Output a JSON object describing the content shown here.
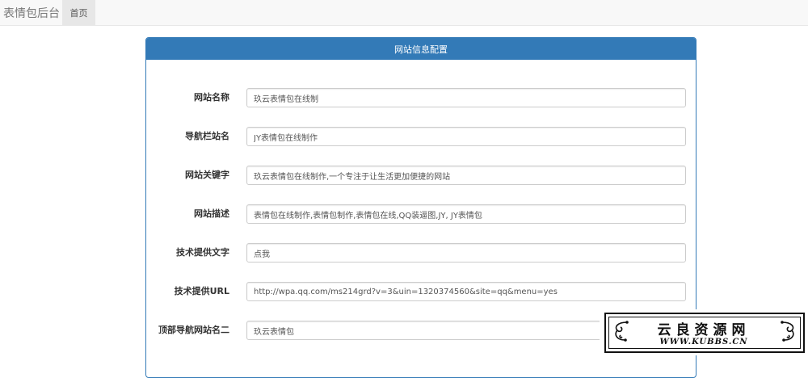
{
  "navbar": {
    "brand": "表情包后台",
    "home": "首页"
  },
  "panel": {
    "title": "网站信息配置"
  },
  "form": [
    {
      "label": "网站名称",
      "value": "玖云表情包在线制"
    },
    {
      "label": "导航栏站名",
      "value": "JY表情包在线制作"
    },
    {
      "label": "网站关键字",
      "value": "玖云表情包在线制作,一个专注于让生活更加便捷的网站"
    },
    {
      "label": "网站描述",
      "value": "表情包在线制作,表情包制作,表情包在线,QQ装逼图,JY, JY表情包"
    },
    {
      "label": "技术提供文字",
      "value": "点我"
    },
    {
      "label": "技术提供URL",
      "value": "http://wpa.qq.com/ms214grd?v=3&uin=1320374560&site=qq&menu=yes"
    },
    {
      "label": "顶部导航网站名二",
      "value": "玖云表情包"
    }
  ],
  "watermark": {
    "title": "云良资源网",
    "url": "WWW.KUBBS.CN"
  }
}
